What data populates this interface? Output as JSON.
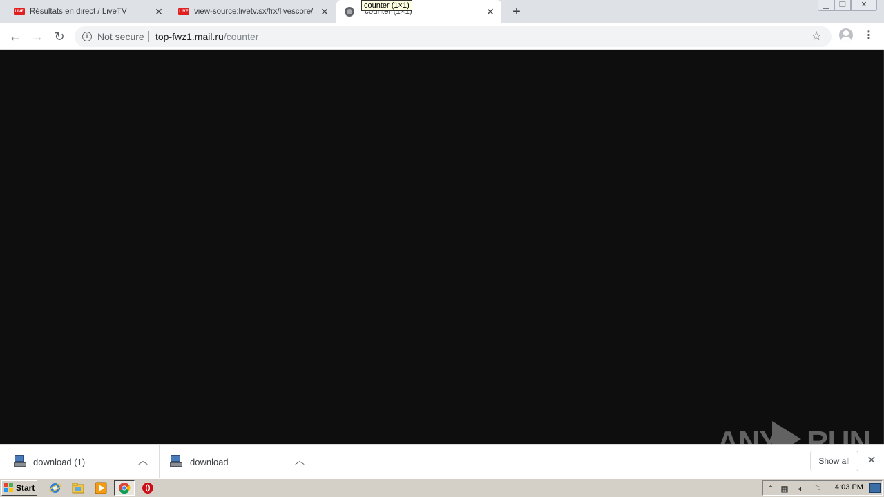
{
  "browser": {
    "tabs": [
      {
        "title": "Résultats en direct / LiveTV",
        "favicon": "live-icon",
        "favicon_text": "LIVE",
        "active": false
      },
      {
        "title": "view-source:livetv.sx/frx/livescore/",
        "favicon": "live-icon",
        "favicon_text": "LIVE",
        "active": false
      },
      {
        "title": "counter (1×1)",
        "favicon": "globe-icon",
        "active": true
      }
    ],
    "tooltip": "counter (1×1)",
    "new_tab_glyph": "+",
    "close_glyph": "✕",
    "address": {
      "security_label": "Not secure",
      "url_host": "top-fwz1.mail.ru",
      "url_path": "/counter"
    }
  },
  "downloads": {
    "items": [
      {
        "name": "download (1)"
      },
      {
        "name": "download"
      }
    ],
    "show_all_label": "Show all"
  },
  "watermark": {
    "left": "ANY",
    "right": "RUN"
  },
  "taskbar": {
    "start_label": "Start",
    "clock": "4:03 PM"
  },
  "colors": {
    "content_bg": "#0e0e0e",
    "tabstrip_bg": "#dee1e6",
    "omnibox_bg": "#f1f3f4",
    "taskbar_bg": "#d4d0c8",
    "live_red": "#e02020"
  }
}
